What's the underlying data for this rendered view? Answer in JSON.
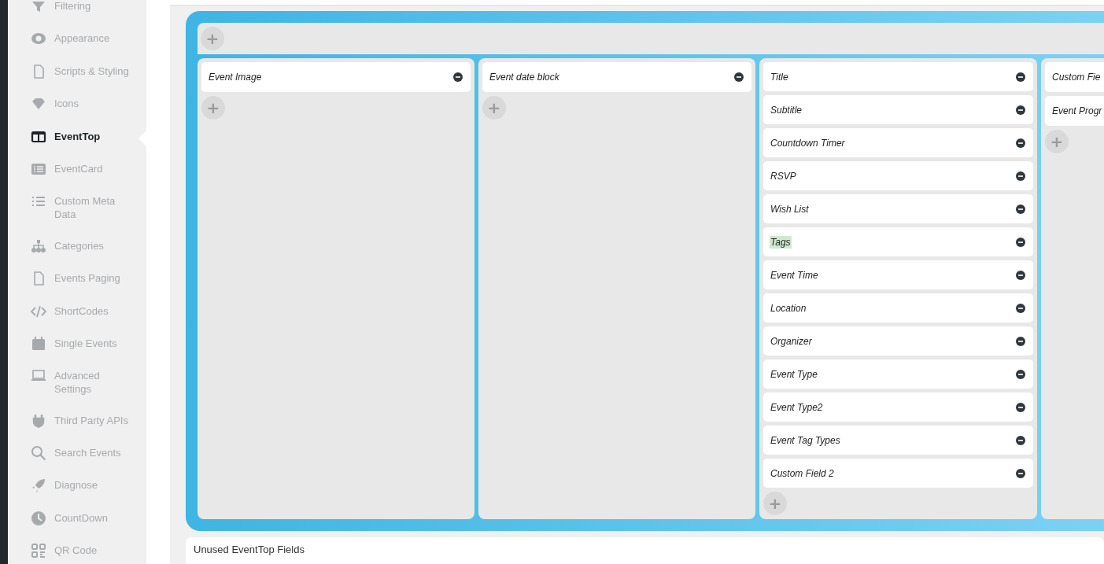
{
  "sidebar": {
    "items": [
      {
        "label": "Filtering",
        "selected": false
      },
      {
        "label": "Appearance",
        "selected": false
      },
      {
        "label": "Scripts & Styling",
        "selected": false
      },
      {
        "label": "Icons",
        "selected": false
      },
      {
        "label": "EventTop",
        "selected": true
      },
      {
        "label": "EventCard",
        "selected": false
      },
      {
        "label": "Custom Meta Data",
        "selected": false
      },
      {
        "label": "Categories",
        "selected": false
      },
      {
        "label": "Events Paging",
        "selected": false
      },
      {
        "label": "ShortCodes",
        "selected": false
      },
      {
        "label": "Single Events",
        "selected": false
      },
      {
        "label": "Advanced Settings",
        "selected": false
      },
      {
        "label": "Third Party APIs",
        "selected": false
      },
      {
        "label": "Search Events",
        "selected": false
      },
      {
        "label": "Diagnose",
        "selected": false
      },
      {
        "label": "CountDown",
        "selected": false
      },
      {
        "label": "QR Code",
        "selected": false
      }
    ]
  },
  "layout": {
    "add_row_button": "+",
    "columns": [
      {
        "fields": [
          {
            "label": "Event Image",
            "highlighted": false
          }
        ],
        "add_button": "+"
      },
      {
        "fields": [
          {
            "label": "Event date block",
            "highlighted": false
          }
        ],
        "add_button": "+"
      },
      {
        "fields": [
          {
            "label": "Title",
            "highlighted": false
          },
          {
            "label": "Subtitle",
            "highlighted": false
          },
          {
            "label": "Countdown Timer",
            "highlighted": false
          },
          {
            "label": "RSVP",
            "highlighted": false
          },
          {
            "label": "Wish List",
            "highlighted": false
          },
          {
            "label": "Tags",
            "highlighted": true
          },
          {
            "label": "Event Time",
            "highlighted": false
          },
          {
            "label": "Location",
            "highlighted": false
          },
          {
            "label": "Organizer",
            "highlighted": false
          },
          {
            "label": "Event Type",
            "highlighted": false
          },
          {
            "label": "Event Type2",
            "highlighted": false
          },
          {
            "label": "Event Tag Types",
            "highlighted": false
          },
          {
            "label": "Custom Field 2",
            "highlighted": false
          }
        ],
        "add_button": "+"
      },
      {
        "fields": [
          {
            "label": "Custom Fie",
            "highlighted": false
          },
          {
            "label": "Event Progr",
            "highlighted": false
          }
        ],
        "add_button": "+"
      }
    ]
  },
  "unused_panel": {
    "title": "Unused EventTop Fields"
  }
}
